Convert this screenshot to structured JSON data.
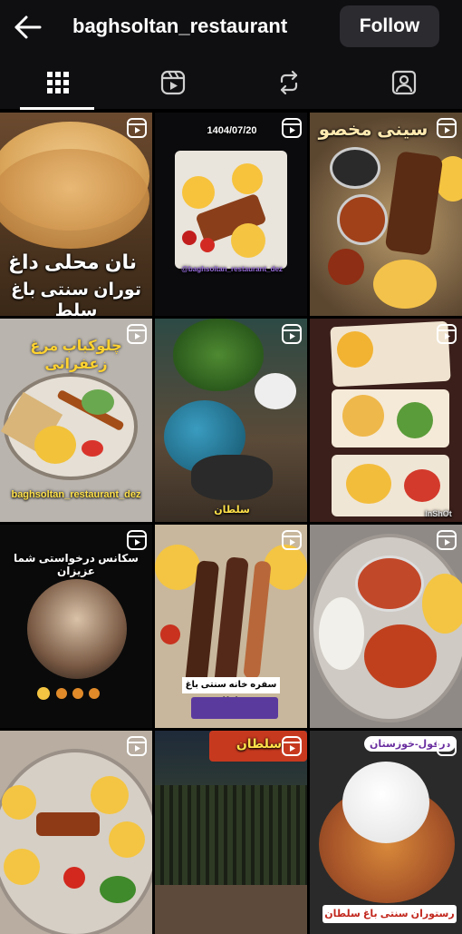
{
  "header": {
    "username": "baghsoltan_restaurant",
    "follow_label": "Follow"
  },
  "tabs": [
    {
      "name": "posts-grid",
      "icon": "grid-icon",
      "active": true
    },
    {
      "name": "reels",
      "icon": "reels-icon",
      "active": false
    },
    {
      "name": "reposts",
      "icon": "repost-icon",
      "active": false
    },
    {
      "name": "tagged",
      "icon": "tagged-person-icon",
      "active": false
    }
  ],
  "posts": [
    {
      "caption": "نان محلی داغ",
      "caption2": "توران سنتی باغ سلط",
      "type": "reel"
    },
    {
      "date": "1404/07/20",
      "watermark": "@baghsoltan_restaurant_dez",
      "type": "reel"
    },
    {
      "caption": "سینی مخصو",
      "type": "reel"
    },
    {
      "caption": "چلوکباب مرغ زعفرانی",
      "handle": "baghsoltan_restaurant_dez",
      "type": "reel"
    },
    {
      "caption": "سلطان",
      "type": "reel"
    },
    {
      "watermark": "InShOt",
      "type": "reel"
    },
    {
      "caption": "سکانس درخواستی شما عزیزان",
      "type": "reel"
    },
    {
      "caption": "سفره خانه سنتی باغ سلطان",
      "type": "reel"
    },
    {
      "type": "reel"
    },
    {
      "type": "reel"
    },
    {
      "caption": "سلطان",
      "type": "reel"
    },
    {
      "caption": "رستوران سنتی باغ سلطان",
      "tag": "دزفول-خوزستان",
      "type": "reel"
    }
  ],
  "colors": {
    "background": "#000000",
    "bar": "#0f0f12",
    "follow_bg": "#2b2b30"
  }
}
